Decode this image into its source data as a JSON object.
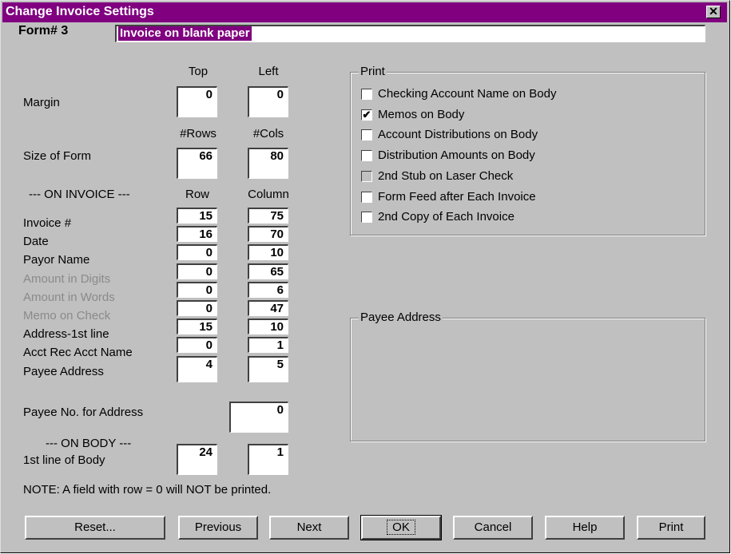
{
  "window": {
    "title": "Change Invoice Settings",
    "close_glyph": "✕"
  },
  "form": {
    "label": "Form# 3",
    "name": "Invoice on blank paper"
  },
  "headers": {
    "top": "Top",
    "left": "Left",
    "rows": "#Rows",
    "cols": "#Cols",
    "on_invoice": "--- ON INVOICE ---",
    "row": "Row",
    "column": "Column",
    "on_body": "--- ON BODY ---"
  },
  "margin": {
    "label": "Margin",
    "top": "0",
    "left": "0"
  },
  "size": {
    "label": "Size of Form",
    "rows": "66",
    "cols": "80"
  },
  "fields": [
    {
      "label": "Invoice #",
      "row": "15",
      "col": "75",
      "disabled": false
    },
    {
      "label": "Date",
      "row": "16",
      "col": "70",
      "disabled": false
    },
    {
      "label": "Payor Name",
      "row": "0",
      "col": "10",
      "disabled": false
    },
    {
      "label": "Amount in Digits",
      "row": "0",
      "col": "65",
      "disabled": true
    },
    {
      "label": "Amount in Words",
      "row": "0",
      "col": "6",
      "disabled": true
    },
    {
      "label": "Memo on Check",
      "row": "0",
      "col": "47",
      "disabled": true
    },
    {
      "label": "Address-1st line",
      "row": "15",
      "col": "10",
      "disabled": false
    },
    {
      "label": "Acct Rec Acct Name",
      "row": "0",
      "col": "1",
      "disabled": false
    },
    {
      "label": "Payee Address",
      "row": "4",
      "col": "5",
      "disabled": false
    }
  ],
  "payee_no": {
    "label": "Payee No. for Address",
    "value": "0"
  },
  "body_line": {
    "label": "1st line of Body",
    "row": "24",
    "col": "1"
  },
  "note": "NOTE: A field with row = 0 will NOT be printed.",
  "print_group": {
    "legend": "Print",
    "items": [
      {
        "label": "Checking Account Name on Body",
        "checked": false,
        "disabled": false
      },
      {
        "label": "Memos on Body",
        "checked": true,
        "disabled": false
      },
      {
        "label": "Account Distributions on Body",
        "checked": false,
        "disabled": false
      },
      {
        "label": "Distribution Amounts on Body",
        "checked": false,
        "disabled": false
      },
      {
        "label": "2nd Stub on Laser Check",
        "checked": false,
        "disabled": true
      },
      {
        "label": "Form Feed after Each Invoice",
        "checked": false,
        "disabled": false
      },
      {
        "label": "2nd Copy of Each Invoice",
        "checked": false,
        "disabled": false
      }
    ]
  },
  "payee_group": {
    "legend": "Payee Address"
  },
  "buttons": {
    "reset": "Reset...",
    "previous": "Previous",
    "next": "Next",
    "ok": "OK",
    "cancel": "Cancel",
    "help": "Help",
    "print": "Print"
  }
}
